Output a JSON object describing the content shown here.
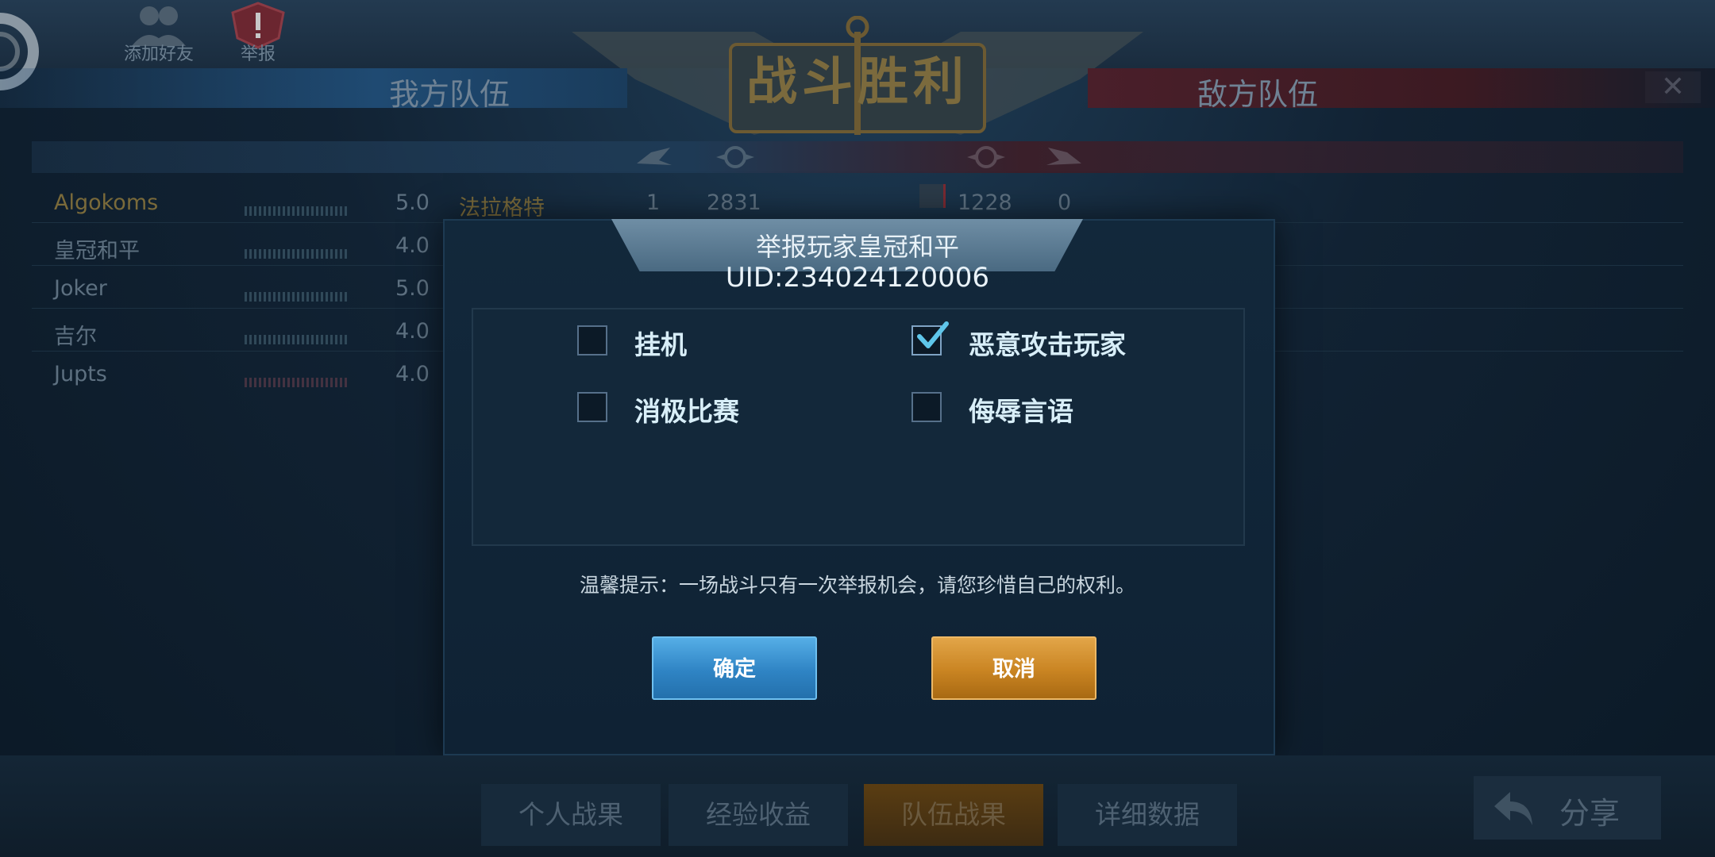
{
  "top": {
    "add_friend_label": "添加好友",
    "report_label": "举报",
    "banner_title": "战斗胜利",
    "close_glyph": "✕"
  },
  "teams": {
    "ally_label": "我方队伍",
    "enemy_label": "敌方队伍"
  },
  "ally_players": [
    {
      "name": "Algokoms",
      "score": "5.0"
    },
    {
      "name": "皇冠和平",
      "score": "4.0"
    },
    {
      "name": "Joker",
      "score": "5.0"
    },
    {
      "name": "吉尔",
      "score": "4.0"
    },
    {
      "name": "Jupts",
      "score": "4.0"
    }
  ],
  "match_row": {
    "ship": "法拉格特",
    "ally_kills": "1",
    "ally_damage": "2831",
    "enemy_damage": "1228",
    "enemy_kills": "0"
  },
  "dialog": {
    "title": "举报玩家皇冠和平",
    "uid": "UID:234024120006",
    "reasons": [
      {
        "label": "挂机",
        "checked": false
      },
      {
        "label": "恶意攻击玩家",
        "checked": true
      },
      {
        "label": "消极比赛",
        "checked": false
      },
      {
        "label": "侮辱言语",
        "checked": false
      }
    ],
    "tip": "温馨提示：一场战斗只有一次举报机会，请您珍惜自己的权利。",
    "confirm_label": "确定",
    "cancel_label": "取消"
  },
  "tabs": [
    {
      "label": "个人战果",
      "active": false
    },
    {
      "label": "经验收益",
      "active": false
    },
    {
      "label": "队伍战果",
      "active": true
    },
    {
      "label": "详细数据",
      "active": false
    }
  ],
  "share_label": "分享",
  "colors": {
    "accent_blue": "#3a95d6",
    "accent_orange": "#d08b28",
    "check_color": "#5fc6ea"
  }
}
